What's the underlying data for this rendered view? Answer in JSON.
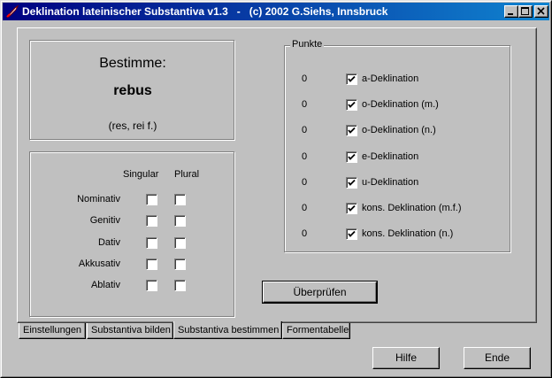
{
  "window": {
    "title": "Deklination lateinischer Substantiva v1.3   -   (c) 2002 G.Siehs, Innsbruck",
    "accent": "#000080"
  },
  "bestimme": {
    "label": "Bestimme:",
    "word": "rebus",
    "hint": "(res, rei f.)"
  },
  "grid": {
    "col_singular": "Singular",
    "col_plural": "Plural",
    "rows": [
      {
        "label": "Nominativ",
        "singular": false,
        "plural": false
      },
      {
        "label": "Genitiv",
        "singular": false,
        "plural": false
      },
      {
        "label": "Dativ",
        "singular": false,
        "plural": false
      },
      {
        "label": "Akkusativ",
        "singular": false,
        "plural": false
      },
      {
        "label": "Ablativ",
        "singular": false,
        "plural": false
      }
    ]
  },
  "punkte": {
    "legend": "Punkte",
    "items": [
      {
        "score": "0",
        "label": "a-Deklination",
        "checked": true
      },
      {
        "score": "0",
        "label": "o-Deklination (m.)",
        "checked": true
      },
      {
        "score": "0",
        "label": "o-Deklination (n.)",
        "checked": true
      },
      {
        "score": "0",
        "label": "e-Deklination",
        "checked": true
      },
      {
        "score": "0",
        "label": "u-Deklination",
        "checked": true
      },
      {
        "score": "0",
        "label": "kons. Deklination (m.f.)",
        "checked": true
      },
      {
        "score": "0",
        "label": "kons. Deklination (n.)",
        "checked": true
      }
    ]
  },
  "check_button": "Überprüfen",
  "tabs": [
    "Einstellungen",
    "Substantiva bilden",
    "Substantiva bestimmen",
    "Formentabelle"
  ],
  "active_tab": 2,
  "help_button": "Hilfe",
  "end_button": "Ende"
}
